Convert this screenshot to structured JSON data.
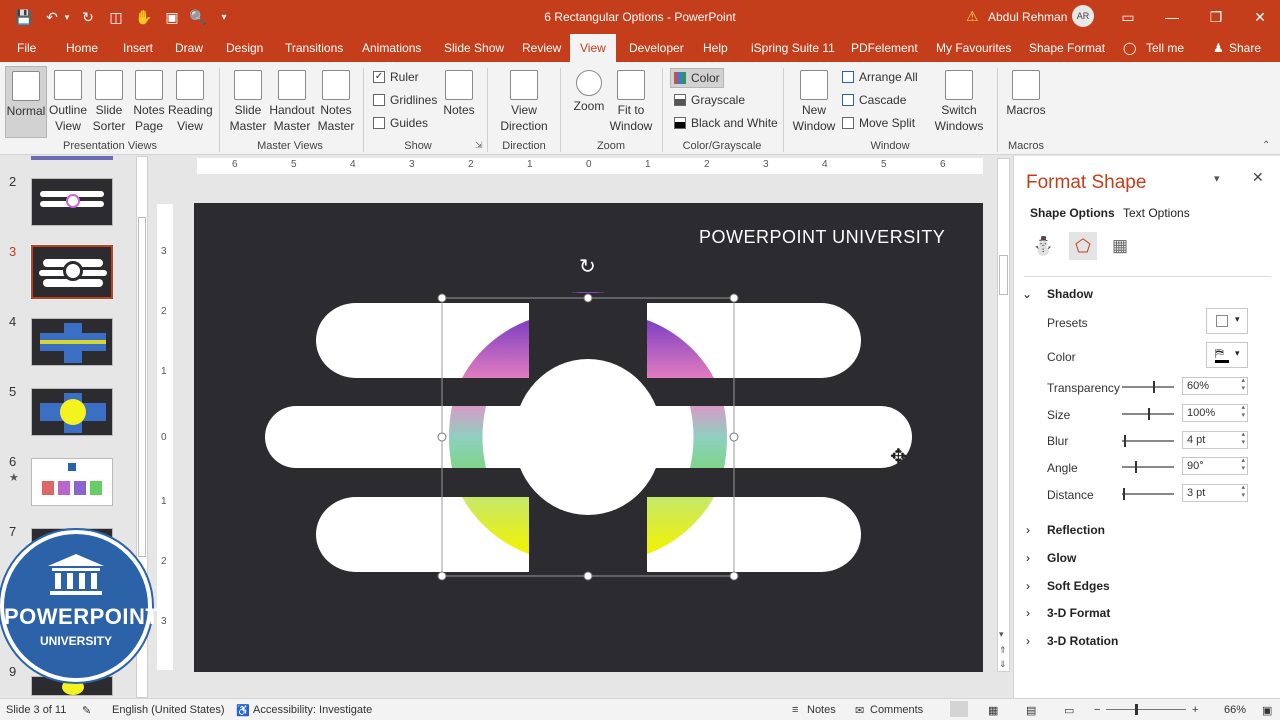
{
  "window": {
    "doc_title": "6 Rectangular Options  -  PowerPoint",
    "user": "Abdul Rehman",
    "avatar": "AR",
    "accent": "#c43e1c"
  },
  "quick_access": [
    "save-icon",
    "undo-icon",
    "redo-icon",
    "present-icon",
    "touch-icon",
    "screenshot-icon",
    "preview-icon",
    "customize-icon"
  ],
  "tabs": [
    "File",
    "Home",
    "Insert",
    "Draw",
    "Design",
    "Transitions",
    "Animations",
    "Slide Show",
    "Review",
    "View",
    "Developer",
    "Help",
    "iSpring Suite 11",
    "PDFelement",
    "My Favourites",
    "Shape Format",
    "Tell me",
    "Share"
  ],
  "active_tab": "View",
  "ribbon": {
    "presentation_views": {
      "label": "Presentation Views",
      "buttons": [
        "Normal",
        "Outline View",
        "Slide Sorter",
        "Notes Page",
        "Reading View"
      ]
    },
    "master_views": {
      "label": "Master Views",
      "buttons": [
        "Slide Master",
        "Handout Master",
        "Notes Master"
      ]
    },
    "show": {
      "label": "Show",
      "checks": [
        {
          "label": "Ruler",
          "checked": true
        },
        {
          "label": "Gridlines",
          "checked": false
        },
        {
          "label": "Guides",
          "checked": false
        }
      ],
      "notes": "Notes"
    },
    "direction": {
      "label": "Direction",
      "button": "View Direction"
    },
    "zoom": {
      "label": "Zoom",
      "buttons": [
        "Zoom",
        "Fit to Window"
      ]
    },
    "color": {
      "label": "Color/Grayscale",
      "buttons": [
        "Color",
        "Grayscale",
        "Black and White"
      ]
    },
    "window": {
      "label": "Window",
      "new_window": "New Window",
      "arrange_all": "Arrange All",
      "cascade": "Cascade",
      "move_split": "Move Split",
      "switch": "Switch Windows"
    },
    "macros": {
      "label": "Macros",
      "button": "Macros"
    }
  },
  "thumbnails": [
    "2",
    "3",
    "4",
    "5",
    "6",
    "7",
    "9"
  ],
  "selected_slide": "3",
  "ruler": {
    "h": [
      "6",
      "5",
      "4",
      "3",
      "2",
      "1",
      "0",
      "1",
      "2",
      "3",
      "4",
      "5",
      "6"
    ],
    "v": [
      "3",
      "2",
      "1",
      "0",
      "1",
      "2",
      "3"
    ]
  },
  "slide": {
    "title": "POWERPOINT UNIVERSITY"
  },
  "format_pane": {
    "title": "Format Shape",
    "subtabs": [
      "Shape Options",
      "Text Options"
    ],
    "section": "Shadow",
    "presets_label": "Presets",
    "color_label": "Color",
    "props": [
      {
        "label": "Transparency",
        "value": "60%"
      },
      {
        "label": "Size",
        "value": "100%"
      },
      {
        "label": "Blur",
        "value": "4 pt"
      },
      {
        "label": "Angle",
        "value": "90°"
      },
      {
        "label": "Distance",
        "value": "3 pt"
      }
    ],
    "collapsed": [
      "Reflection",
      "Glow",
      "Soft Edges",
      "3-D Format",
      "3-D Rotation"
    ]
  },
  "status": {
    "slide": "Slide 3 of 11",
    "language": "English (United States)",
    "accessibility": "Accessibility: Investigate",
    "notes": "Notes",
    "comments": "Comments",
    "zoom": "66%"
  },
  "logo": {
    "name": "POWERPOINT",
    "sub": "UNIVERSITY"
  }
}
